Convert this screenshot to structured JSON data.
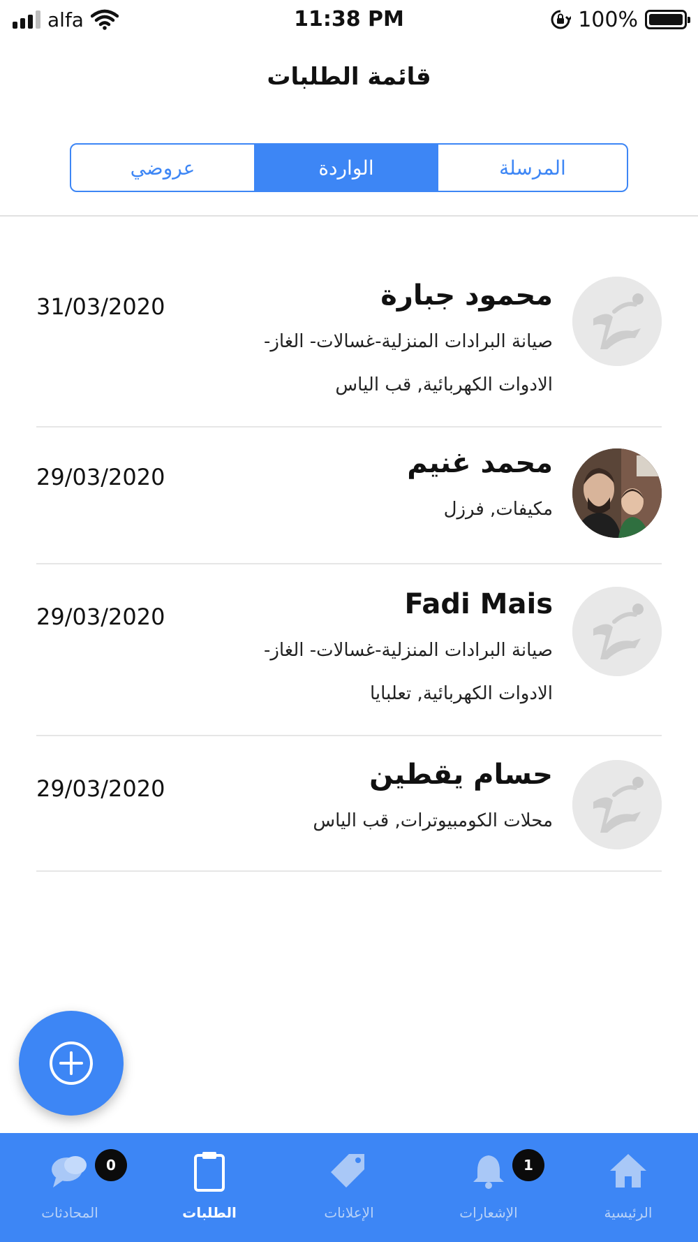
{
  "status_bar": {
    "carrier": "alfa",
    "time": "11:38 PM",
    "battery": "100%"
  },
  "header": {
    "title": "قائمة الطلبات"
  },
  "tabs": [
    {
      "label": "عروضي",
      "active": false
    },
    {
      "label": "الواردة",
      "active": true
    },
    {
      "label": "المرسلة",
      "active": false
    }
  ],
  "requests": [
    {
      "name": "محمود جبارة",
      "description": "صيانة البرادات المنزلية-غسالات- الغاز- الادوات الكهربائية, قب الياس",
      "date": "31/03/2020",
      "avatar": "placeholder-logo"
    },
    {
      "name": "محمد غنيم",
      "description": "مكيفات, فرزل",
      "date": "29/03/2020",
      "avatar": "user-photo"
    },
    {
      "name": "Fadi Mais",
      "description": "صيانة البرادات المنزلية-غسالات- الغاز- الادوات الكهربائية, تعلبايا",
      "date": "29/03/2020",
      "avatar": "placeholder-logo"
    },
    {
      "name": "حسام يقطين",
      "description": "محلات الكومبيوترات, قب الياس",
      "date": "29/03/2020",
      "avatar": "placeholder-logo"
    }
  ],
  "fab": {
    "icon": "plus-circle-icon"
  },
  "bottom_nav": [
    {
      "label": "المحادثات",
      "icon": "chat-icon",
      "badge": "0",
      "active": false
    },
    {
      "label": "الطلبات",
      "icon": "clipboard-icon",
      "badge": "",
      "active": true
    },
    {
      "label": "الإعلانات",
      "icon": "tag-icon",
      "badge": "",
      "active": false
    },
    {
      "label": "الإشعارات",
      "icon": "bell-icon",
      "badge": "1",
      "active": false
    },
    {
      "label": "الرئيسية",
      "icon": "home-icon",
      "badge": "",
      "active": false
    }
  ],
  "colors": {
    "accent": "#3d86f5",
    "divider": "#e6e6e6"
  }
}
